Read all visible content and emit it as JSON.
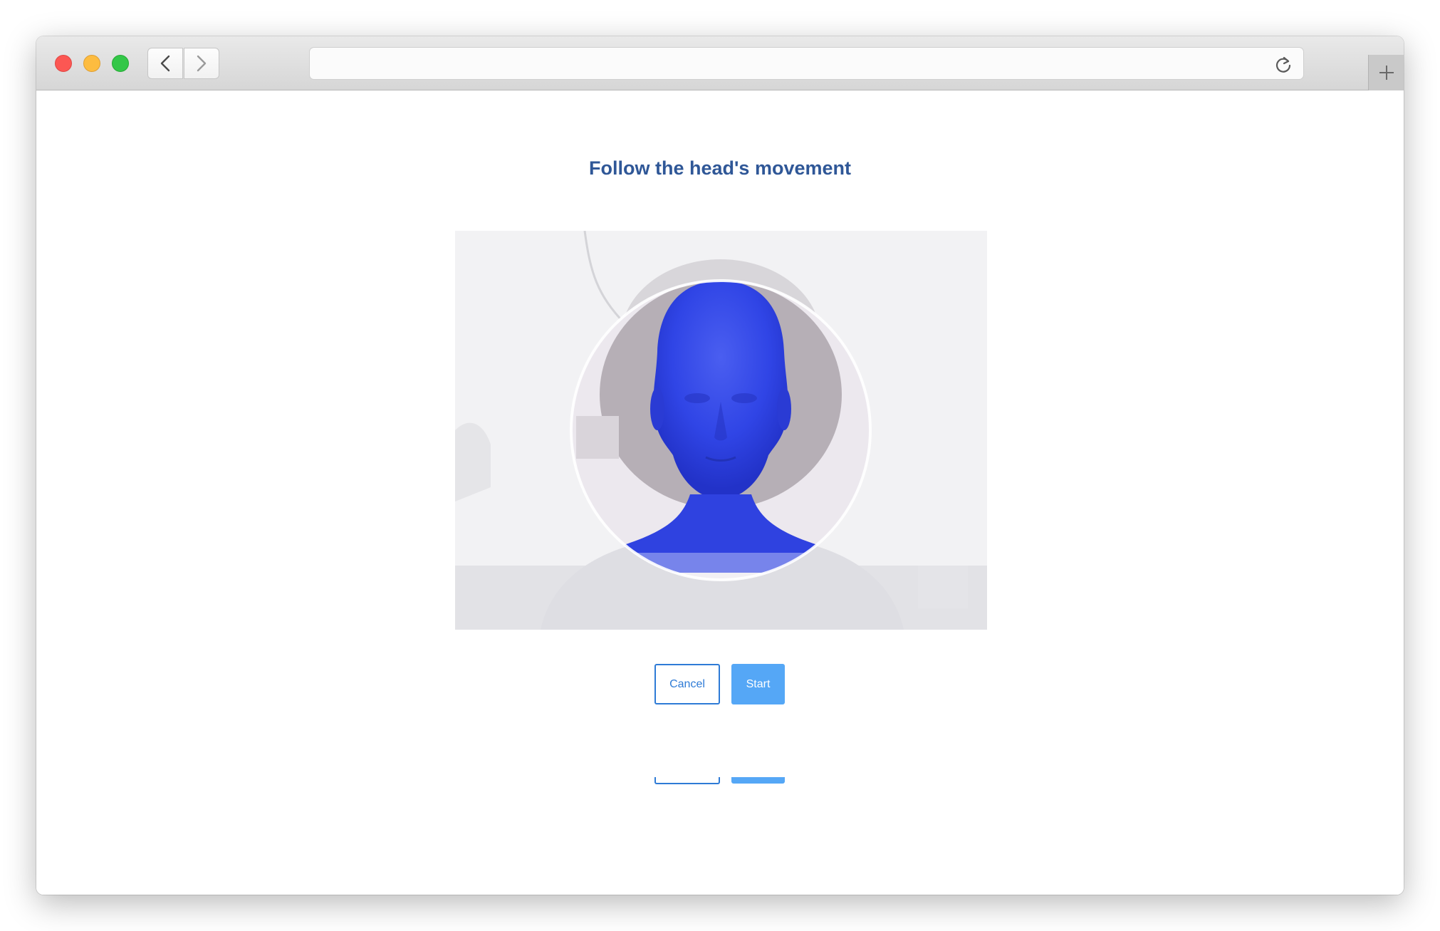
{
  "browser": {
    "address_value": "",
    "icons": {
      "back": "chevron-left-icon",
      "forward": "chevron-right-icon",
      "reload": "reload-icon",
      "new_tab": "plus-icon"
    },
    "traffic_lights": [
      "#fc5753",
      "#fdbc40",
      "#33c748"
    ]
  },
  "page": {
    "title": "Follow the head's movement",
    "title_color": "#2f5797",
    "camera_feed": {
      "overlay": "3d-head-model",
      "overlay_color": "#2b3fe0"
    },
    "buttons": {
      "cancel_label": "Cancel",
      "start_label": "Start",
      "accent_color": "#2e7bd6",
      "start_color": "#55a7f6"
    }
  }
}
